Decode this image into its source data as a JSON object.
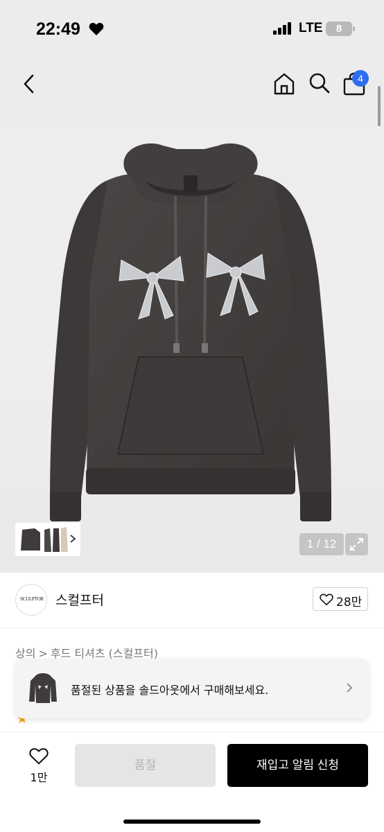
{
  "status_bar": {
    "time": "22:49",
    "network": "LTE",
    "battery": "8"
  },
  "nav": {
    "cart_badge": "4"
  },
  "gallery": {
    "counter": "1 / 12"
  },
  "brand": {
    "logo_text": "SCULPTOR",
    "name": "스컬프터",
    "likes": "28만"
  },
  "breadcrumb": {
    "category": "상의",
    "separator": ">",
    "subcategory": "후드 티셔츠 (스컬프터)"
  },
  "soldout_banner": {
    "text": "품절된 상품을 솔드아웃에서 구매해보세요."
  },
  "bottom_bar": {
    "wish_count": "1만",
    "soldout_label": "품절",
    "restock_label": "재입고 알림 신청"
  },
  "colors": {
    "accent_blue": "#2f6cf0",
    "primary_black": "#000000",
    "disabled_gray": "#e5e5e5"
  },
  "icons": [
    "heart-icon",
    "signal-icon",
    "back-icon",
    "home-icon",
    "search-icon",
    "bag-icon",
    "expand-icon",
    "chevron-right-icon"
  ]
}
